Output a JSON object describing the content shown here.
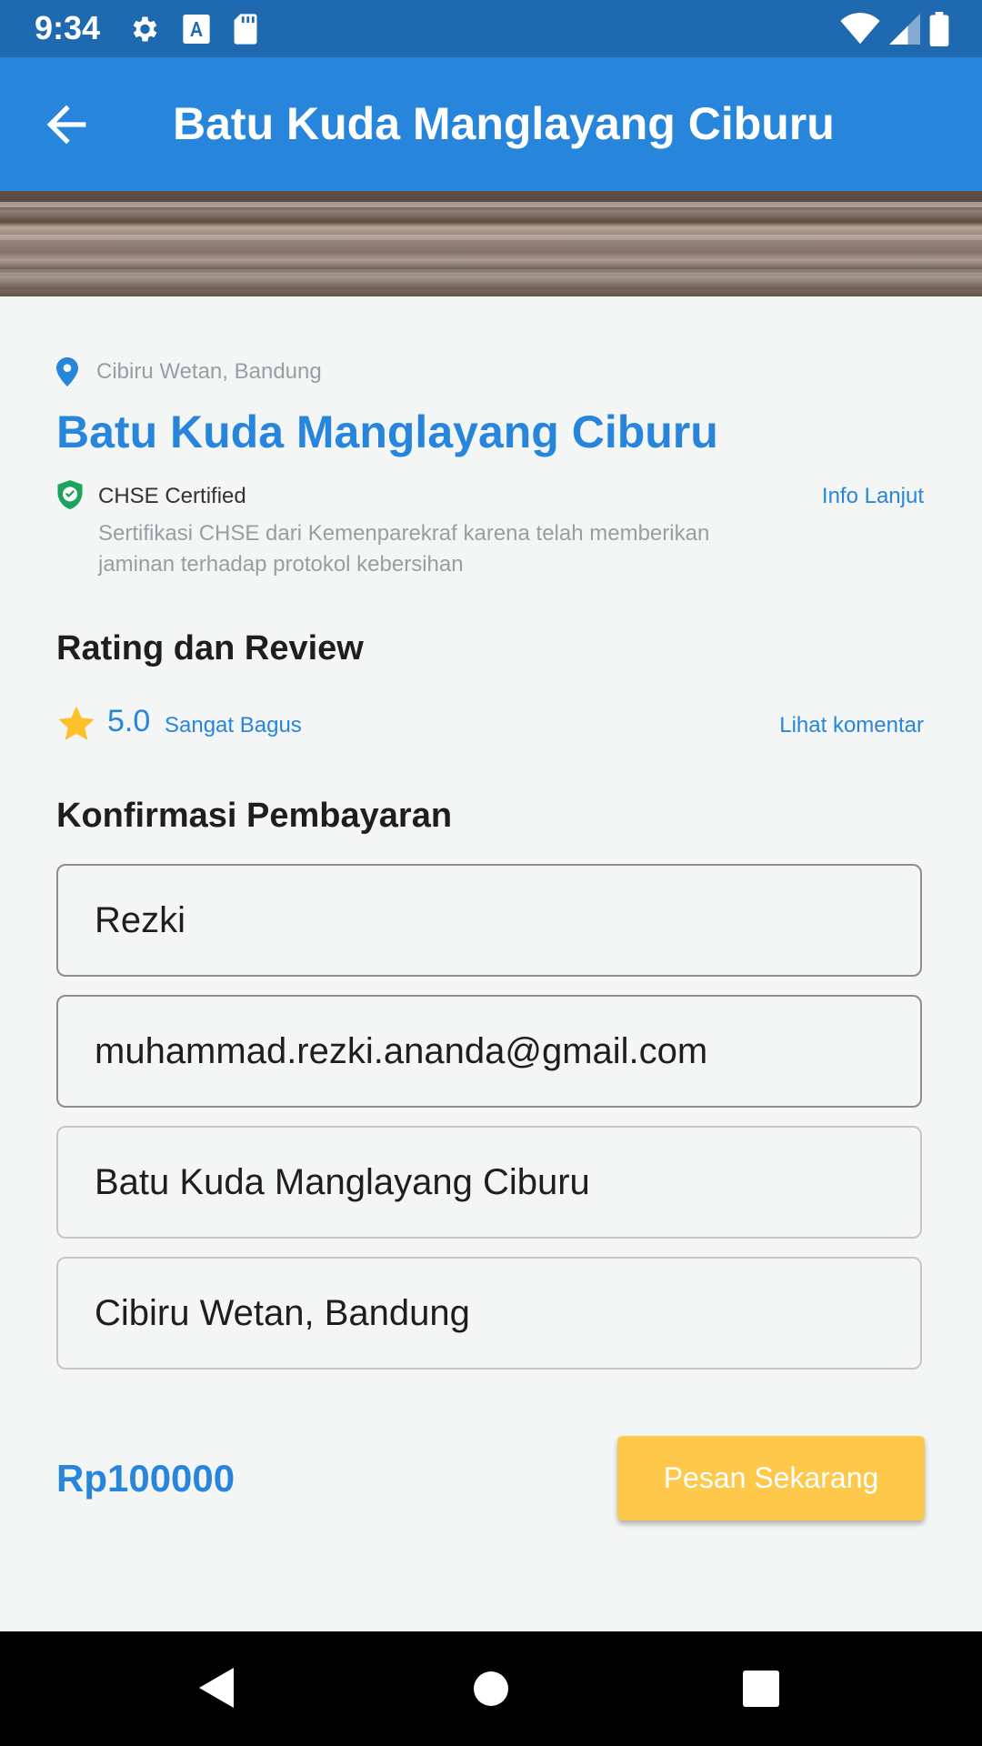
{
  "status_bar": {
    "time": "9:34",
    "icons_left": [
      "gear-icon",
      "a-icon",
      "sd-card-icon"
    ],
    "icons_right": [
      "wifi-icon",
      "signal-icon",
      "battery-icon"
    ]
  },
  "app_bar": {
    "back_icon": "arrow-left-icon",
    "title": "Batu Kuda Manglayang Ciburu"
  },
  "detail": {
    "location": "Cibiru Wetan, Bandung",
    "title": "Batu Kuda Manglayang Ciburu",
    "chse": {
      "label": "CHSE Certified",
      "info_link": "Info Lanjut",
      "description": "Sertifikasi CHSE dari Kemenparekraf karena telah memberikan jaminan terhadap protokol kebersihan"
    }
  },
  "rating": {
    "section_title": "Rating dan Review",
    "value": "5.0",
    "label": "Sangat Bagus",
    "comment_link": "Lihat komentar"
  },
  "payment": {
    "section_title": "Konfirmasi Pembayaran",
    "name": "Rezki",
    "email": "muhammad.rezki.ananda@gmail.com",
    "destination": "Batu Kuda Manglayang Ciburu",
    "address": "Cibiru Wetan, Bandung"
  },
  "footer": {
    "price": "Rp100000",
    "order_button": "Pesan Sekarang"
  },
  "colors": {
    "primary": "#2786dc",
    "status_bar": "#1f69b0",
    "button": "#fec84a",
    "shield": "#1aa45e"
  }
}
